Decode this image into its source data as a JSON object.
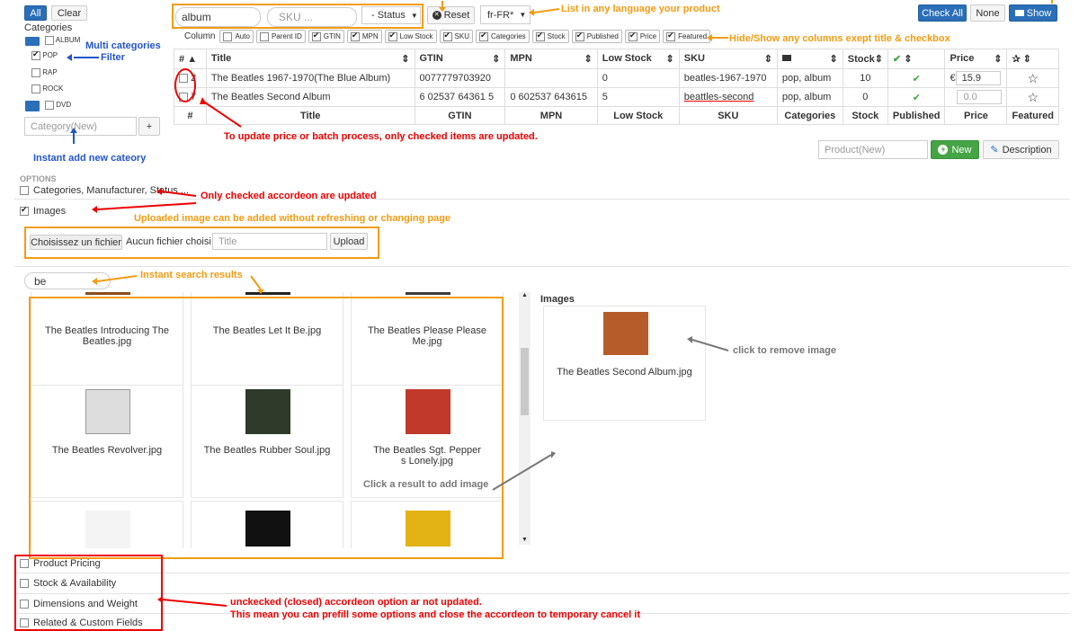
{
  "left": {
    "all_label": "All",
    "clear_label": "Clear",
    "categories_label": "Categories",
    "categories": [
      {
        "label": "ALBUM",
        "checked": false
      },
      {
        "label": "POP",
        "checked": true
      },
      {
        "label": "RAP",
        "checked": false
      },
      {
        "label": "ROCK",
        "checked": false
      },
      {
        "label": "DVD",
        "checked": false
      }
    ],
    "category_new_placeholder": "Category(New)",
    "plus_label": "+"
  },
  "toolbar": {
    "search_value": "album",
    "sku_placeholder": "SKU ...",
    "status_label": "- Status",
    "reset_label": "Reset",
    "lang_label": "fr-FR*",
    "check_all": "Check All",
    "none": "None",
    "show": "Show"
  },
  "columns_bar": {
    "label": "Column",
    "chips": [
      {
        "label": "Auto",
        "checked": false
      },
      {
        "label": "Parent ID",
        "checked": false
      },
      {
        "label": "GTIN",
        "checked": true
      },
      {
        "label": "MPN",
        "checked": true
      },
      {
        "label": "Low Stock",
        "checked": true
      },
      {
        "label": "SKU",
        "checked": true
      },
      {
        "label": "Categories",
        "checked": true
      },
      {
        "label": "Stock",
        "checked": true
      },
      {
        "label": "Published",
        "checked": true
      },
      {
        "label": "Price",
        "checked": true
      },
      {
        "label": "Featured",
        "checked": true
      }
    ]
  },
  "table": {
    "headers": [
      "#",
      "Title",
      "GTIN",
      "MPN",
      "Low Stock",
      "SKU",
      "",
      "Stock",
      "",
      "Price",
      ""
    ],
    "footers": [
      "#",
      "Title",
      "GTIN",
      "MPN",
      "Low Stock",
      "SKU",
      "Categories",
      "Stock",
      "Published",
      "Price",
      "Featured"
    ],
    "rows": [
      {
        "id": "2",
        "title": "The Beatles 1967-1970(The Blue Album)",
        "gtin": "0077779703920",
        "mpn": "",
        "low": "0",
        "sku": "beatles-1967-1970",
        "cats": "pop, album",
        "stock": "10",
        "price": "15.9",
        "currency": "€"
      },
      {
        "id": "7",
        "title": "The Beatles Second Album",
        "gtin": "6 02537 64361 5",
        "mpn": "0 602537 643615",
        "low": "5",
        "sku": "beattles-second",
        "cats": "pop, album",
        "stock": "0",
        "price": "0.0",
        "currency": ""
      }
    ]
  },
  "product_new_placeholder": "Product(New)",
  "new_label": "New",
  "description_label": "Description",
  "options": {
    "heading": "OPTIONS",
    "cat_row": "Categories, Manufacturer, Status ...",
    "images_row": "Images",
    "file_button": "Choisissez un fichier",
    "file_status": "Aucun fichier choisi",
    "title_placeholder": "Title",
    "upload": "Upload",
    "search_value": "be",
    "images_label": "Images",
    "results": [
      "The Beatles Introducing The Beatles.jpg",
      "The Beatles Let It Be.jpg",
      "The Beatles Please Please Me.jpg",
      "The Beatles Revolver.jpg",
      "The Beatles Rubber Soul.jpg",
      "The Beatles Sgt. Pepper s Lonely.jpg"
    ],
    "selected_image": "The Beatles Second Album.jpg",
    "accordions": [
      "Product Pricing",
      "Stock & Availability",
      "Dimensions and Weight",
      "Related & Custom Fields"
    ]
  },
  "annotations": {
    "multi_cat": "Multi categories",
    "filter": "Filter",
    "lang": "List in any language your product",
    "hide_show": "Hide/Show any columns exept title & checkbox",
    "update_price": "To update price or batch process, only checked items are updated.",
    "instant_add": "Instant add new cateory",
    "only_checked": "Only checked accordeon are updated",
    "uploaded": "Uploaded image can be added without refreshing or changing page",
    "instant_search": "Instant search results",
    "click_remove": "click to remove image",
    "click_result": "Click a result to add image",
    "unchecked_1": "unckecked (closed) accordeon option ar not updated.",
    "unchecked_2": "This mean you can prefill some options and close the accordeon to temporary cancel it"
  }
}
